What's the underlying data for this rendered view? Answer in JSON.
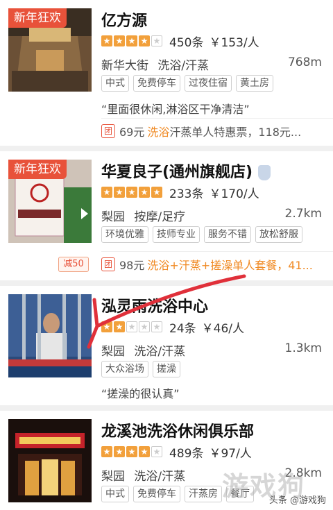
{
  "listings": [
    {
      "promo": "新年狂欢",
      "name": "亿方源",
      "stars": 4,
      "reviews": "450条",
      "price": "￥153/人",
      "area": "新华大街",
      "category": "洗浴/汗蒸",
      "distance": "768m",
      "tags": [
        "中式",
        "免费停车",
        "过夜住宿",
        "黄土房"
      ],
      "quote": "“里面很休闲,淋浴区干净清洁”",
      "deal_icon": "团",
      "deal_price": "69元",
      "deal_highlight": "洗浴",
      "deal_text": "汗蒸单人特惠票，118元..."
    },
    {
      "promo": "新年狂欢",
      "name": "华夏良子(通州旗舰店)",
      "stars": 5,
      "reviews": "233条",
      "price": "￥170/人",
      "area": "梨园",
      "category": "按摩/足疗",
      "distance": "2.7km",
      "tags": [
        "环境优雅",
        "技师专业",
        "服务不错",
        "放松舒服"
      ],
      "discount": "减50",
      "deal_icon": "团",
      "deal_price": "98元",
      "deal_highlight": "洗浴",
      "deal_text": "+汗蒸+搓澡单人套餐，41..."
    },
    {
      "name": "泓灵雨洗浴中心",
      "stars": 2,
      "reviews": "24条",
      "price": "￥46/人",
      "area": "梨园",
      "category": "洗浴/汗蒸",
      "distance": "1.3km",
      "tags": [
        "大众浴场",
        "搓澡"
      ],
      "quote": "“搓澡的很认真”"
    },
    {
      "name": "龙溪池洗浴休闲俱乐部",
      "stars": 4,
      "reviews": "489条",
      "price": "￥97/人",
      "area": "梨园",
      "category": "洗浴/汗蒸",
      "distance": "2.8km",
      "tags": [
        "中式",
        "免费停车",
        "汗蒸房",
        "餐厅"
      ]
    }
  ],
  "watermark": {
    "source": "头条 @游戏狗",
    "big": "游戏狗"
  },
  "colors": {
    "promo": "#e8523a",
    "star": "#f2a03b",
    "deal_highlight": "#f08a24",
    "arrow": "#e0303a"
  }
}
